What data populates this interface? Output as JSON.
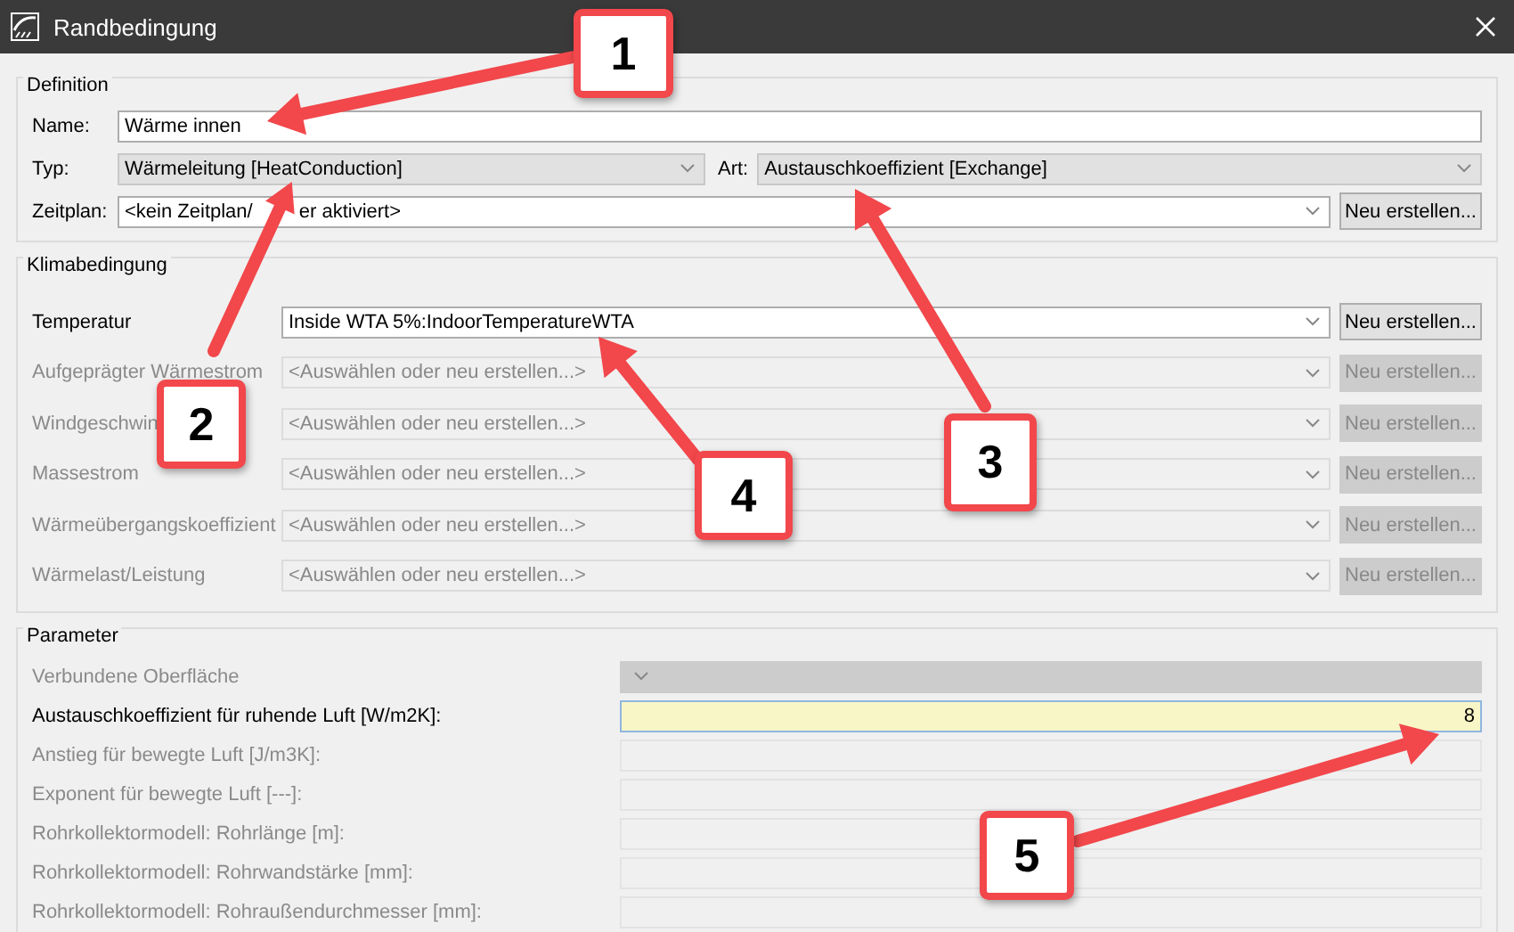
{
  "window": {
    "title": "Randbedingung"
  },
  "definition": {
    "title": "Definition",
    "name": {
      "label": "Name:",
      "value": "Wärme innen"
    },
    "type": {
      "label": "Typ:",
      "value": "Wärmeleitung [HeatConduction]"
    },
    "art": {
      "label": "Art:",
      "value": "Austauschkoeffizient [Exchange]"
    },
    "schedule": {
      "label": "Zeitplan:",
      "value": [
        "<kein Zeitplan/",
        "er aktiviert>"
      ],
      "button": "Neu erstellen..."
    }
  },
  "climate": {
    "title": "Klimabedingung",
    "rows": [
      {
        "label": "Temperatur",
        "value": "Inside WTA 5%:IndoorTemperatureWTA",
        "disabled": false,
        "button": "Neu erstellen..."
      },
      {
        "label": "Aufgeprägter Wärmestrom",
        "value": "<Auswählen oder neu erstellen...>",
        "disabled": true,
        "button": "Neu erstellen..."
      },
      {
        "label": "Windgeschwin",
        "value": "<Auswählen oder neu erstellen...>",
        "disabled": true,
        "button": "Neu erstellen..."
      },
      {
        "label": "Massestrom",
        "value": "<Auswählen oder neu erstellen...>",
        "disabled": true,
        "button": "Neu erstellen..."
      },
      {
        "label": "Wärmeübergangskoeffizient",
        "value": "<Auswählen oder neu erstellen...>",
        "disabled": true,
        "button": "Neu erstellen..."
      },
      {
        "label": "Wärmelast/Leistung",
        "value": "<Auswählen oder neu erstellen...>",
        "disabled": true,
        "button": "Neu erstellen..."
      }
    ]
  },
  "parameters": {
    "title": "Parameter",
    "rows": [
      {
        "label": "Verbundene Oberfläche",
        "kind": "combo",
        "disabled": true
      },
      {
        "label": "Austauschkoeffizient für ruhende Luft [W/m2K]:",
        "kind": "field",
        "disabled": false,
        "value": "8"
      },
      {
        "label": "Anstieg für bewegte Luft [J/m3K]:",
        "kind": "field",
        "disabled": true
      },
      {
        "label": "Exponent für bewegte Luft [---]:",
        "kind": "field",
        "disabled": true
      },
      {
        "label": "Rohrkollektormodell: Rohrlänge [m]:",
        "kind": "field",
        "disabled": true
      },
      {
        "label": "Rohrkollektormodell: Rohrwandstärke [mm]:",
        "kind": "field",
        "disabled": true
      },
      {
        "label": "Rohrkollektormodell: Rohraußendurchmesser [mm]:",
        "kind": "field",
        "disabled": true
      }
    ]
  },
  "callouts": [
    {
      "number": "1"
    },
    {
      "number": "2"
    },
    {
      "number": "3"
    },
    {
      "number": "4"
    },
    {
      "number": "5"
    }
  ]
}
